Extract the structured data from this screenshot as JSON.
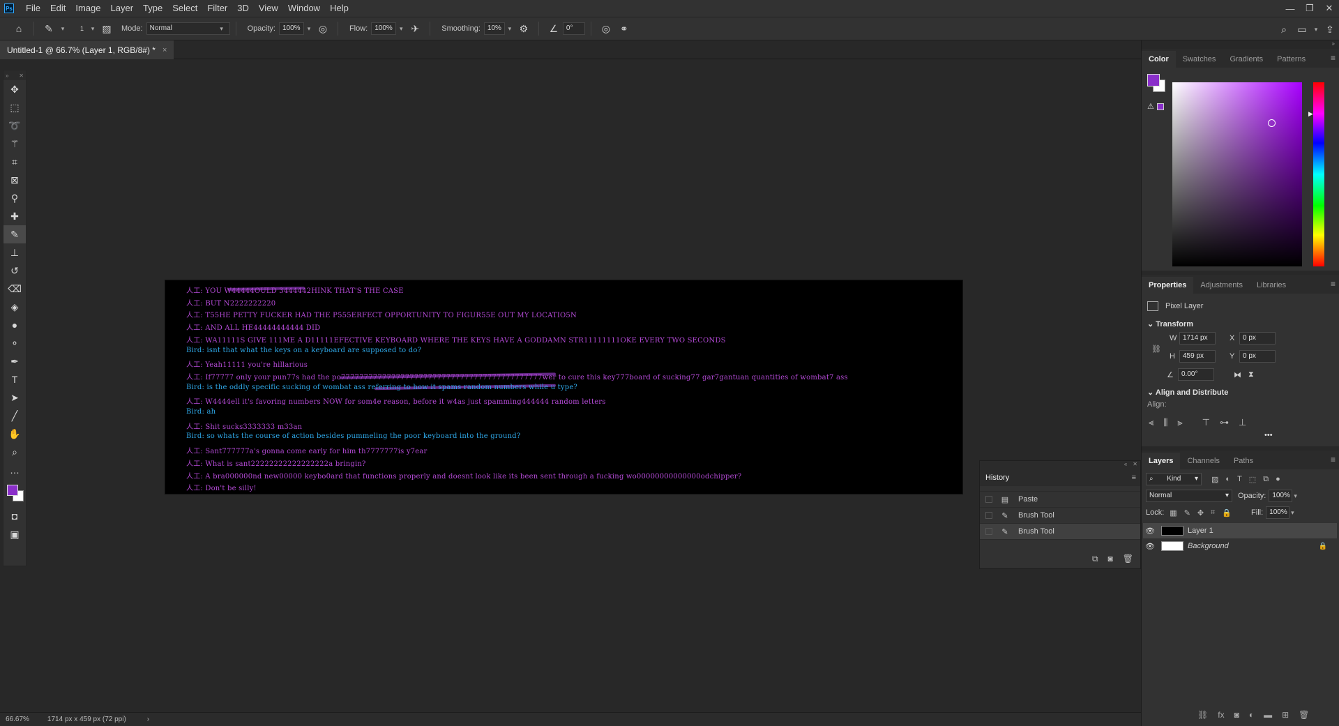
{
  "app": {
    "logo_text": "Ps"
  },
  "menu": [
    "File",
    "Edit",
    "Image",
    "Layer",
    "Type",
    "Select",
    "Filter",
    "3D",
    "View",
    "Window",
    "Help"
  ],
  "window_controls": {
    "minimize": "—",
    "restore": "❐",
    "close": "✕"
  },
  "options": {
    "brush_size": "1",
    "mode_label": "Mode:",
    "mode_value": "Normal",
    "opacity_label": "Opacity:",
    "opacity_value": "100%",
    "flow_label": "Flow:",
    "flow_value": "100%",
    "smoothing_label": "Smoothing:",
    "smoothing_value": "10%",
    "angle_value": "0°"
  },
  "document": {
    "tab_title": "Untitled-1 @ 66.7% (Layer 1, RGB/8#) *",
    "close": "×"
  },
  "canvas_lines": [
    {
      "speaker": "ai",
      "text": "人工: YOU W44444OULD 3444442HINK THAT'S THE CASE"
    },
    {
      "speaker": "ai",
      "text": "人工: BUT N2222222220"
    },
    {
      "speaker": "ai",
      "text": "人工: T55HE PETTY FUCKER HAD THE P555ERFECT OPPORTUNITY TO FIGUR55E OUT MY LOCATIO5N"
    },
    {
      "speaker": "ai",
      "text": "人工: AND ALL HE44444444444 DID"
    },
    {
      "speaker": "ai",
      "text": "人工: WA11111S GIVE 111ME A D11111EFECTIVE KEYBOARD WHERE THE KEYS HAVE A GODDAMN STR11111111OKE EVERY TWO SECONDS"
    },
    {
      "speaker": "bird",
      "text": "Bird: isnt that what the keys on a keyboard are supposed to do?"
    },
    {
      "speaker": "ai",
      "text": "人工: Yeah11111 you're hillarious"
    },
    {
      "speaker": "ai",
      "text": "人工: If77777 only your pun77s had the po77777777777777777777777777777777777777777777wer to cure this key777board of sucking77 gar7gantuan quantities of wombat7 ass"
    },
    {
      "speaker": "bird",
      "text": "Bird: is the oddly specific sucking of wombat ass referring to how it spams random numbers while u type?"
    },
    {
      "speaker": "ai",
      "text": "人工: W4444ell it's favoring numbers NOW for som4e reason, before it w4as just spamming444444 random letters"
    },
    {
      "speaker": "bird",
      "text": "Bird: ah"
    },
    {
      "speaker": "ai",
      "text": "人工: Shit sucks3333333 m33an"
    },
    {
      "speaker": "bird",
      "text": "Bird: so whats the course of action besides pummeling the poor keyboard into the ground?"
    },
    {
      "speaker": "ai",
      "text": "人工: Sant777777a's gonna come early for him th7777777is y7ear"
    },
    {
      "speaker": "ai",
      "text": "人工: What is sant22222222222222222a bringin?"
    },
    {
      "speaker": "ai",
      "text": "人工: A bra000000nd new00000 keybo0ard that functions properly and doesnt look like its been sent through a fucking wo00000000000000odchipper?"
    },
    {
      "speaker": "ai",
      "text": "人工: Don't be silly!"
    }
  ],
  "status": {
    "zoom": "66.67%",
    "doc_info": "1714 px x 459 px (72 ppi)",
    "arrow": "›"
  },
  "color_panel": {
    "tabs": [
      "Color",
      "Swatches",
      "Gradients",
      "Patterns"
    ],
    "fg": "#8a2fc9",
    "bg": "#ffffff"
  },
  "properties_panel": {
    "tabs": [
      "Properties",
      "Adjustments",
      "Libraries"
    ],
    "kind": "Pixel Layer",
    "transform_title": "Transform",
    "w_label": "W",
    "w_value": "1714 px",
    "h_label": "H",
    "h_value": "459 px",
    "x_label": "X",
    "x_value": "0 px",
    "y_label": "Y",
    "y_value": "0 px",
    "angle_value": "0.00°",
    "align_title": "Align and Distribute",
    "align_label": "Align:",
    "more": "•••"
  },
  "history_panel": {
    "title": "History",
    "items": [
      {
        "label": "Paste",
        "icon": "document-icon",
        "selected": false
      },
      {
        "label": "Brush Tool",
        "icon": "brush-icon",
        "selected": false
      },
      {
        "label": "Brush Tool",
        "icon": "brush-icon",
        "selected": true
      }
    ]
  },
  "layers_panel": {
    "tabs": [
      "Layers",
      "Channels",
      "Paths"
    ],
    "filter_label": "Kind",
    "blend_mode": "Normal",
    "opacity_label": "Opacity:",
    "opacity_value": "100%",
    "lock_label": "Lock:",
    "fill_label": "Fill:",
    "fill_value": "100%",
    "layers": [
      {
        "name": "Layer 1",
        "selected": true,
        "thumb": "#000000"
      },
      {
        "name": "Background",
        "selected": false,
        "thumb": "#ffffff",
        "locked": true
      }
    ]
  }
}
